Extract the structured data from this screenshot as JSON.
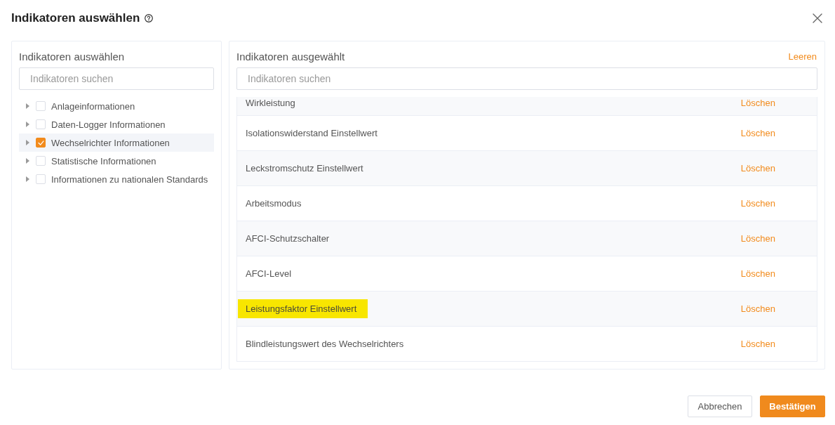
{
  "dialog": {
    "title": "Indikatoren auswählen"
  },
  "left_panel": {
    "title": "Indikatoren auswählen",
    "search": {
      "placeholder": "Indikatoren suchen"
    },
    "tree": [
      {
        "label": "Anlageinformationen",
        "checked": false,
        "selected": false,
        "expanded": false
      },
      {
        "label": "Daten-Logger Informationen",
        "checked": false,
        "selected": false,
        "expanded": false
      },
      {
        "label": "Wechselrichter Informationen",
        "checked": true,
        "selected": true,
        "expanded": false
      },
      {
        "label": "Statistische Informationen",
        "checked": false,
        "selected": false,
        "expanded": false
      },
      {
        "label": "Informationen zu nationalen Standards",
        "checked": false,
        "selected": false,
        "expanded": false
      }
    ]
  },
  "right_panel": {
    "title": "Indikatoren ausgewählt",
    "clear_link": "Leeren",
    "search": {
      "placeholder": "Indikatoren suchen"
    },
    "rows": [
      {
        "label": "Wirkleistung",
        "action": "Löschen",
        "highlighted": false
      },
      {
        "label": "Isolationswiderstand Einstellwert",
        "action": "Löschen",
        "highlighted": false
      },
      {
        "label": "Leckstromschutz Einstellwert",
        "action": "Löschen",
        "highlighted": false
      },
      {
        "label": "Arbeitsmodus",
        "action": "Löschen",
        "highlighted": false
      },
      {
        "label": "AFCI-Schutzschalter",
        "action": "Löschen",
        "highlighted": false
      },
      {
        "label": "AFCI-Level",
        "action": "Löschen",
        "highlighted": false
      },
      {
        "label": "Leistungsfaktor Einstellwert",
        "action": "Löschen",
        "highlighted": true
      },
      {
        "label": "Blindleistungswert des Wechselrichters",
        "action": "Löschen",
        "highlighted": false
      }
    ]
  },
  "buttons": [
    {
      "label": "Abbrechen",
      "kind": "secondary"
    },
    {
      "label": "Bestätigen",
      "kind": "primary"
    }
  ]
}
